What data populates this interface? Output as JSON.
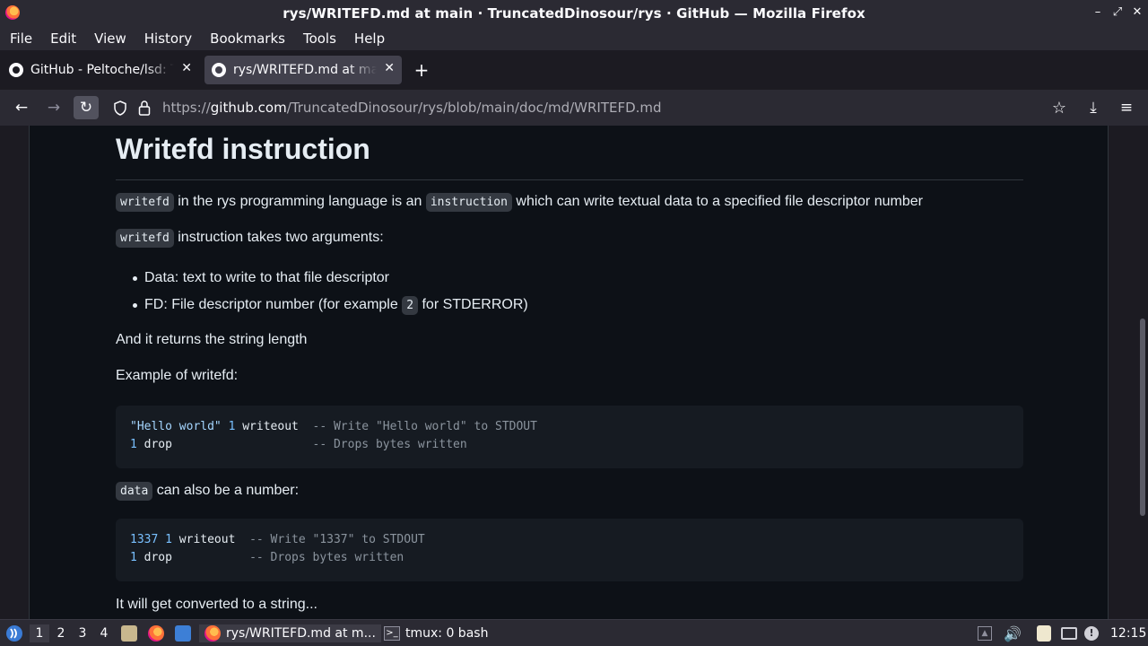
{
  "window": {
    "title": "rys/WRITEFD.md at main · TruncatedDinosour/rys · GitHub — Mozilla Firefox",
    "controls": [
      "–",
      "⤢",
      "✕"
    ]
  },
  "menubar": [
    "File",
    "Edit",
    "View",
    "History",
    "Bookmarks",
    "Tools",
    "Help"
  ],
  "tabs": [
    {
      "label": "GitHub - Peltoche/lsd: Th",
      "active": false
    },
    {
      "label": "rys/WRITEFD.md at main",
      "active": true
    }
  ],
  "newtab_label": "+",
  "url": {
    "prefix": "https://",
    "host": "github.com",
    "path": "/TruncatedDinosour/rys/blob/main/doc/md/WRITEFD.md"
  },
  "doc": {
    "heading": "Writefd instruction",
    "p1": {
      "code1": "writefd",
      "text1": " in the rys programming language is an ",
      "code2": "instruction",
      "text2": " which can write textual data to a specified file descriptor number"
    },
    "p2": {
      "code": "writefd",
      "text": " instruction takes two arguments:"
    },
    "list": [
      {
        "text": "Data: text to write to that file descriptor"
      },
      {
        "pre": "FD: File descriptor number (for example ",
        "code": "2",
        "post": " for STDERROR)"
      }
    ],
    "p3": "And it returns the string length",
    "p4": "Example of writefd:",
    "code1": {
      "l1_str": "\"Hello world\"",
      "l1_num": "1",
      "l1_rest": " writeout  ",
      "l1_cmt": "-- Write \"Hello world\" to STDOUT",
      "l2_num": "1",
      "l2_rest": " drop                    ",
      "l2_cmt": "-- Drops bytes written"
    },
    "p5": {
      "code": "data",
      "text": " can also be a number:"
    },
    "code2": {
      "l1_num": "1337",
      "l1_num2": "1",
      "l1_rest": " writeout  ",
      "l1_cmt": "-- Write \"1337\" to STDOUT",
      "l2_num": "1",
      "l2_rest": " drop           ",
      "l2_cmt": "-- Drops bytes written"
    },
    "p6": "It will get converted to a string..."
  },
  "taskbar": {
    "workspaces": [
      "1",
      "2",
      "3",
      "4"
    ],
    "tasks": [
      {
        "label": "rys/WRITEFD.md at m...",
        "active": true
      },
      {
        "label": "tmux: 0 bash",
        "active": false
      }
    ],
    "clock": "12:15"
  }
}
